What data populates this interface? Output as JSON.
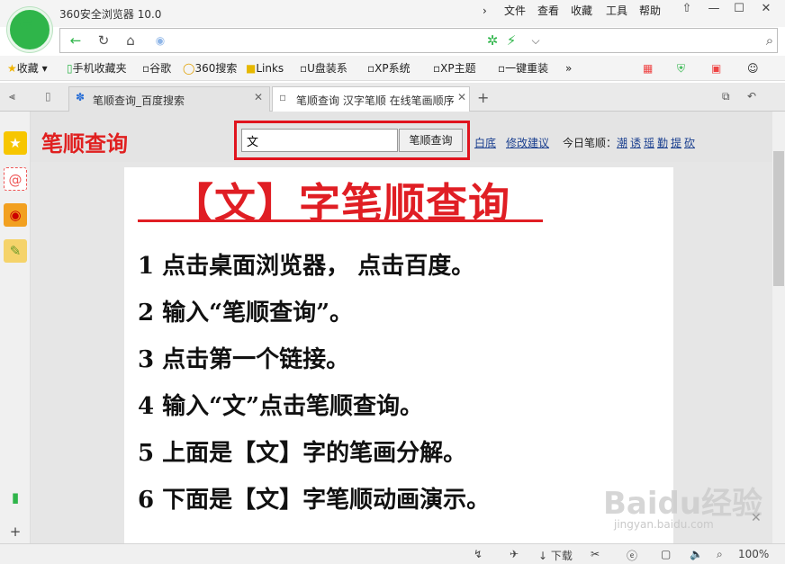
{
  "window": {
    "title": "360安全浏览器 10.0",
    "menu": [
      "文件",
      "查看",
      "收藏",
      "工具",
      "帮助"
    ],
    "controls": [
      "⇧",
      "—",
      "☐",
      "✕"
    ]
  },
  "favorites": {
    "items": [
      "收藏",
      "手机收藏夹",
      "谷歌",
      "360搜索",
      "Links",
      "U盘装系",
      "XP系统",
      "XP主题",
      "一键重装"
    ]
  },
  "tabs": [
    {
      "label": "笔顺查询_百度搜索"
    },
    {
      "label": "笔顺查询 汉字笔顺 在线笔画顺序"
    }
  ],
  "header": {
    "brand": "笔顺查询",
    "input_value": "文",
    "search_button": "笔顺查询",
    "links": [
      "白底",
      "修改建议"
    ],
    "today_label": "今日笔顺：",
    "today_chars": [
      "潮",
      "诱",
      "瑶",
      "勤",
      "提",
      "砍"
    ]
  },
  "article": {
    "title": "【文】字笔顺查询",
    "steps": [
      "1 点击桌面浏览器， 点击百度。",
      "2 输入“笔顺查询”。",
      "3 点击第一个链接。",
      "4 输入“文”点击笔顺查询。",
      "5 上面是【文】字的笔画分解。",
      "6 下面是【文】字笔顺动画演示。"
    ]
  },
  "statusbar": {
    "download": "下载",
    "zoom": "100%"
  },
  "watermark": {
    "logo": "Baidu经验",
    "url": "jingyan.baidu.com"
  },
  "colors": {
    "accent_red": "#e01e24",
    "brand_green": "#2fb54a",
    "link_blue": "#1a3f8f"
  }
}
